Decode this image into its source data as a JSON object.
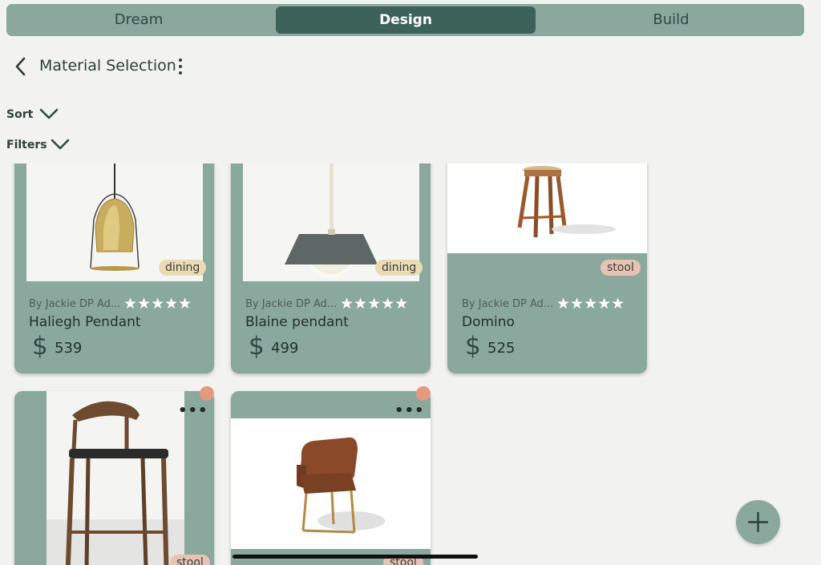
{
  "tabs": [
    {
      "label": "Dream"
    },
    {
      "label": "Design"
    },
    {
      "label": "Build"
    }
  ],
  "header": {
    "title": "Material Selection"
  },
  "sort": {
    "label": "Sort"
  },
  "filters": {
    "label": "Filters"
  },
  "products": [
    {
      "by": "By Jackie DP Ad...",
      "name": "Haliegh Pendant",
      "currency": "$",
      "price": "539",
      "tag": "dining",
      "stars": "★★★★★"
    },
    {
      "by": "By Jackie DP Ad...",
      "name": "Blaine pendant",
      "currency": "$",
      "price": "499",
      "tag": "dining",
      "stars": "★★★★★"
    },
    {
      "by": "By Jackie DP Ad...",
      "name": "Domino",
      "currency": "$",
      "price": "525",
      "tag": "stool",
      "stars": "★★★★★"
    },
    {
      "tag": "stool",
      "menu": "•••"
    },
    {
      "tag": "stool",
      "menu": "•••"
    }
  ],
  "colors": {
    "accent": "#8aa89e",
    "active_tab": "#3d625a",
    "badge": "#e39a7f",
    "tag_dining": "#eadbb4",
    "tag_stool": "#e8c3b3"
  }
}
